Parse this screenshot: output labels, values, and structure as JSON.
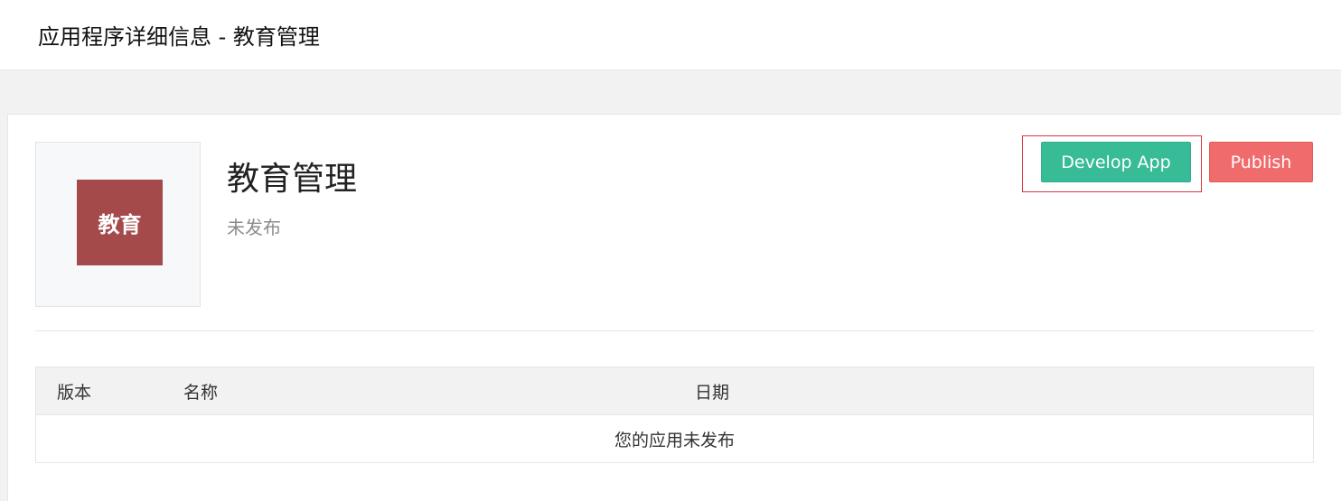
{
  "header": {
    "title": "应用程序详细信息 - 教育管理"
  },
  "app": {
    "icon_text": "教育",
    "icon_color": "#a44a4a",
    "name": "教育管理",
    "status": "未发布"
  },
  "actions": {
    "develop_label": "Develop App",
    "develop_color": "#38bc98",
    "publish_label": "Publish",
    "publish_color": "#f06b6b"
  },
  "table": {
    "columns": [
      "版本",
      "名称",
      "日期"
    ],
    "empty_text": "您的应用未发布"
  }
}
